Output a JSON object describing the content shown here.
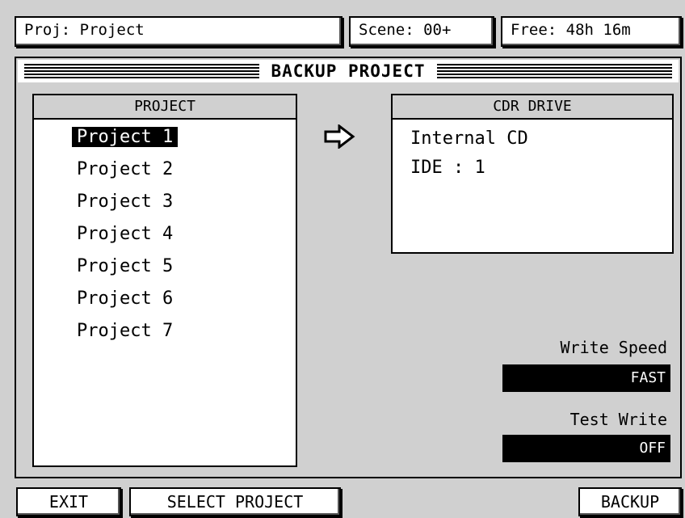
{
  "status": {
    "project": "Proj: Project",
    "scene": "Scene: 00+",
    "free": "Free: 48h 16m"
  },
  "dialog": {
    "title": "BACKUP PROJECT",
    "project_header": "PROJECT",
    "projects": [
      "Project 1",
      "Project 2",
      "Project 3",
      "Project 4",
      "Project 5",
      "Project 6",
      "Project 7"
    ],
    "selected_index": 0,
    "arrow_icon": "right-arrow-icon",
    "drive_header": "CDR DRIVE",
    "drive_name": "Internal CD",
    "drive_bus": "IDE : 1",
    "write_speed_label": "Write Speed",
    "write_speed_value": "FAST",
    "test_write_label": "Test Write",
    "test_write_value": "OFF"
  },
  "softkeys": {
    "exit": "EXIT",
    "select_project": "SELECT PROJECT",
    "backup": "BACKUP"
  }
}
